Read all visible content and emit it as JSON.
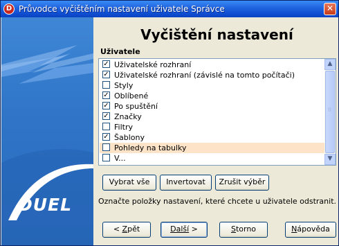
{
  "window": {
    "title": "Průvodce vyčištěním nastavení uživatele Správce",
    "close_glyph": "✕",
    "app_icon_letter": "D"
  },
  "branding": {
    "logo_text": "DUEL",
    "panel_color": "#2f74c7"
  },
  "main": {
    "heading": "Vyčištění nastavení",
    "list_label": "Uživatele",
    "items": [
      {
        "label": "Uživatelské rozhraní",
        "checked": true
      },
      {
        "label": "Uživatelské rozhraní (závislé na tomto počítači)",
        "checked": true
      },
      {
        "label": "Styly",
        "checked": false
      },
      {
        "label": "Oblíbené",
        "checked": true
      },
      {
        "label": "Po spuštění",
        "checked": true
      },
      {
        "label": "Značky",
        "checked": true
      },
      {
        "label": "Filtry",
        "checked": false
      },
      {
        "label": "Šablony",
        "checked": true
      },
      {
        "label": "Pohledy na tabulky",
        "checked": false,
        "highlighted": true
      },
      {
        "label": "V...",
        "checked": false
      }
    ],
    "scroll": {
      "up_glyph": "▲",
      "down_glyph": "▼"
    }
  },
  "actions": {
    "select_all": "Vybrat vše",
    "invert": "Invertovat",
    "deselect": "Zrušit výběr"
  },
  "hint": "Označte položky nastavení, které chcete u uživatele odstranit.",
  "footer": {
    "back": {
      "prefix": "< ",
      "accel": "Z",
      "rest": "pět"
    },
    "next": {
      "accel": "D",
      "rest": "alší",
      "suffix": " >"
    },
    "cancel": {
      "accel": "S",
      "rest": "torno"
    },
    "help": {
      "accel": "N",
      "rest": "ápověda"
    }
  },
  "colors": {
    "titlebar": "#0f4cd0",
    "highlight_row": "#fde4c8",
    "checkbox_border": "#1c5180"
  }
}
